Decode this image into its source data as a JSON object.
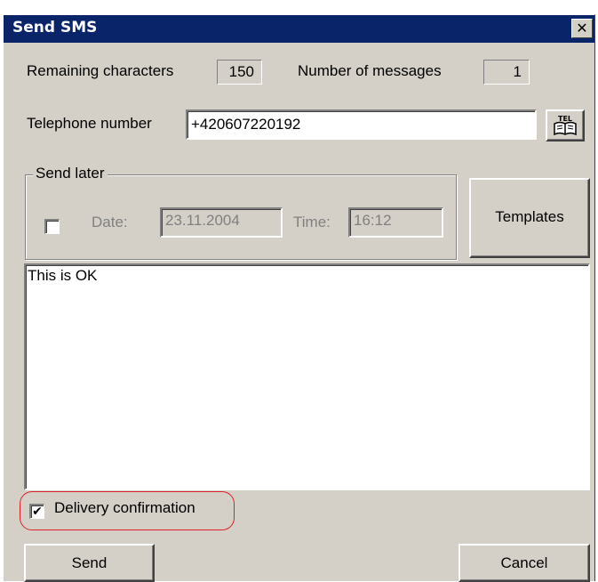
{
  "window": {
    "title": "Send SMS",
    "close_glyph": "✕"
  },
  "counters": {
    "remaining_label": "Remaining characters",
    "remaining_value": "150",
    "messages_label": "Number of messages",
    "messages_value": "1"
  },
  "phone": {
    "label": "Telephone number",
    "value": "+420607220192",
    "phonebook_icon_text": "TEL"
  },
  "send_later": {
    "legend": "Send later",
    "checked": false,
    "date_label": "Date:",
    "date_value": "23.11.2004",
    "time_label": "Time:",
    "time_value": "16:12"
  },
  "templates_button": "Templates",
  "message": {
    "text": "This is OK"
  },
  "delivery": {
    "checked": true,
    "check_glyph": "✔",
    "label": "Delivery confirmation",
    "highlight_color": "#e0202a"
  },
  "actions": {
    "send_label": "Send",
    "cancel_label": "Cancel"
  },
  "colors": {
    "titlebar": "#0a246a",
    "face": "#d4d0c8"
  }
}
